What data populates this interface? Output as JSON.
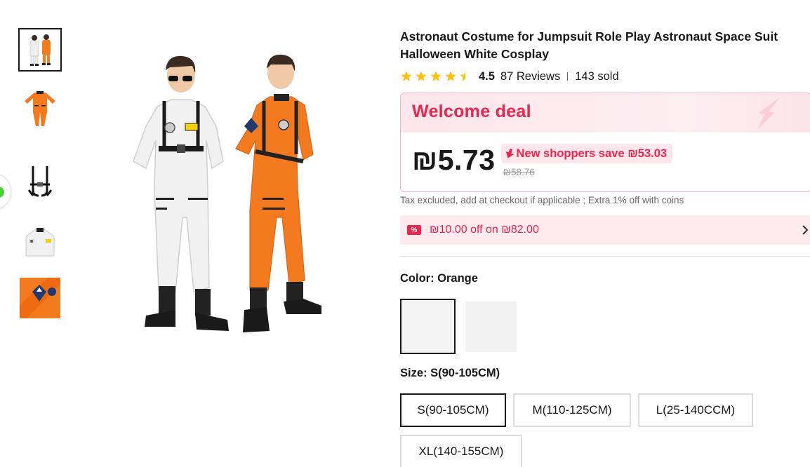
{
  "product": {
    "title": "Astronaut Costume for Jumpsuit Role Play Astronaut Space Suit Halloween White Cosplay",
    "rating": "4.5",
    "reviews": "87 Reviews",
    "sold": "143 sold",
    "rating_stars": 4.5
  },
  "deal": {
    "title": "Welcome deal",
    "price": "₪5.73",
    "save_text": "New shoppers save ₪53.03",
    "original_price": "₪58.76",
    "tax_note": "Tax excluded, add at checkout if applicable ; Extra 1% off with coins"
  },
  "coupon": {
    "tag": "%",
    "text": "₪10.00 off on ₪82.00"
  },
  "color": {
    "label": "Color:",
    "selected": "Orange"
  },
  "size": {
    "label": "Size:",
    "selected": "S(90-105CM)",
    "options": [
      "S(90-105CM)",
      "M(110-125CM)",
      "L(25-140CCM)",
      "XL(140-155CM)"
    ]
  },
  "icons": {
    "star": "star-icon",
    "half_star": "half-star-icon",
    "arrow_down": "arrow-down-icon",
    "chevron": "chevron-right-icon"
  },
  "colors": {
    "accent": "#e8264e",
    "star": "#fdbf10",
    "orange_suit": "#f47a20",
    "white_suit": "#f2f2f2"
  }
}
